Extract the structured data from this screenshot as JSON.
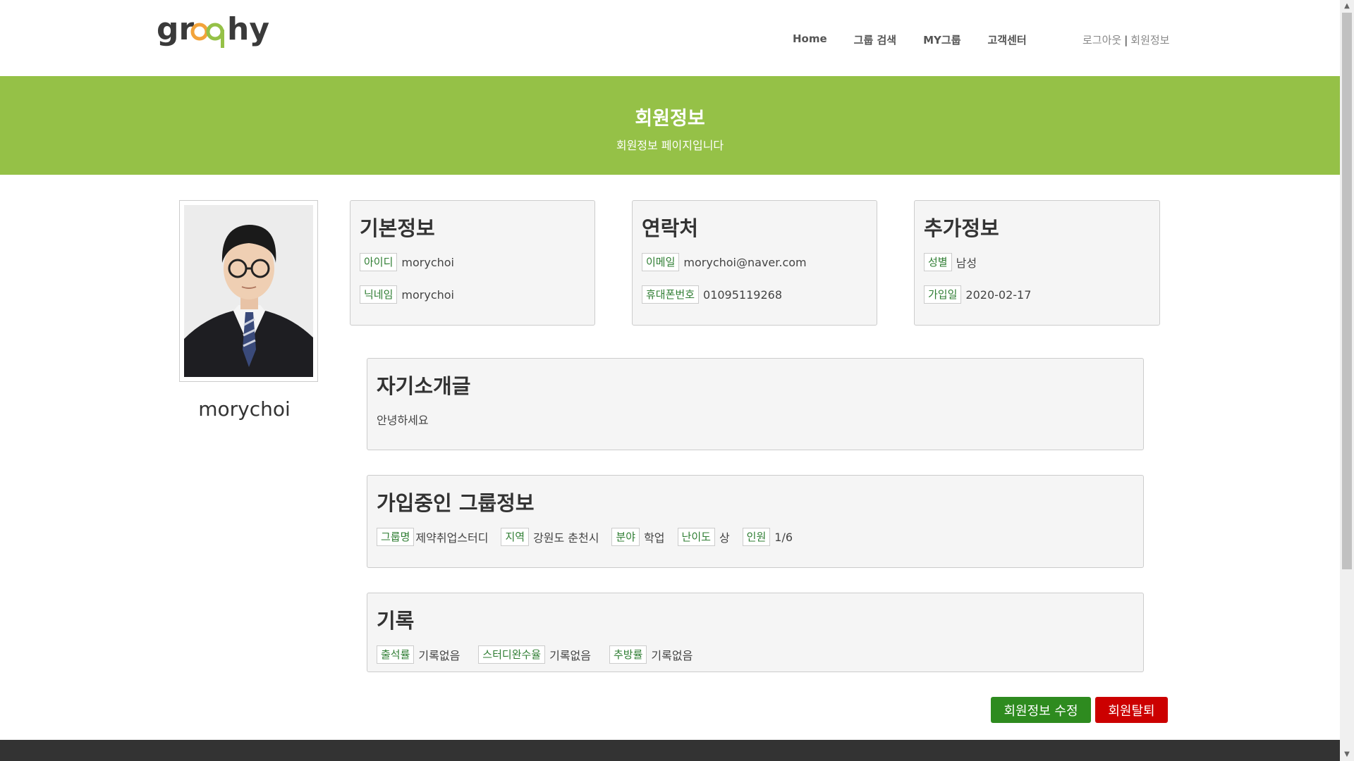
{
  "header": {
    "logo_text": "groophy",
    "nav": [
      "Home",
      "그룹 검색",
      "MY그룹",
      "고객센터"
    ],
    "logout": "로그아웃",
    "separator": "|",
    "member_info": "회원정보"
  },
  "banner": {
    "title": "회원정보",
    "subtitle": "회원정보 페이지입니다"
  },
  "profile": {
    "name": "morychoi"
  },
  "basic": {
    "title": "기본정보",
    "id_label": "아이디",
    "id_value": "morychoi",
    "nick_label": "닉네임",
    "nick_value": "morychoi"
  },
  "contact": {
    "title": "연락처",
    "email_label": "이메일",
    "email_value": "morychoi@naver.com",
    "phone_label": "휴대폰번호",
    "phone_value": "01095119268"
  },
  "extra": {
    "title": "추가정보",
    "gender_label": "성별",
    "gender_value": "남성",
    "join_label": "가입일",
    "join_value": "2020-02-17"
  },
  "intro": {
    "title": "자기소개글",
    "text": "안녕하세요"
  },
  "group": {
    "title": "가입중인 그룹정보",
    "name_label": "그룹명",
    "name_value": "제약취업스터디",
    "region_label": "지역",
    "region_value": "강원도 춘천시",
    "field_label": "분야",
    "field_value": "학업",
    "level_label": "난이도",
    "level_value": "상",
    "members_label": "인원",
    "members_value": "1/6"
  },
  "record": {
    "title": "기록",
    "attend_label": "출석률",
    "attend_value": "기록없음",
    "complete_label": "스터디완수율",
    "complete_value": "기록없음",
    "expel_label": "추방률",
    "expel_value": "기록없음"
  },
  "buttons": {
    "edit": "회원정보 수정",
    "quit": "회원탈퇴"
  },
  "colors": {
    "banner": "#95c147",
    "edit_button": "#2e8b1f",
    "quit_button": "#cc0000"
  }
}
